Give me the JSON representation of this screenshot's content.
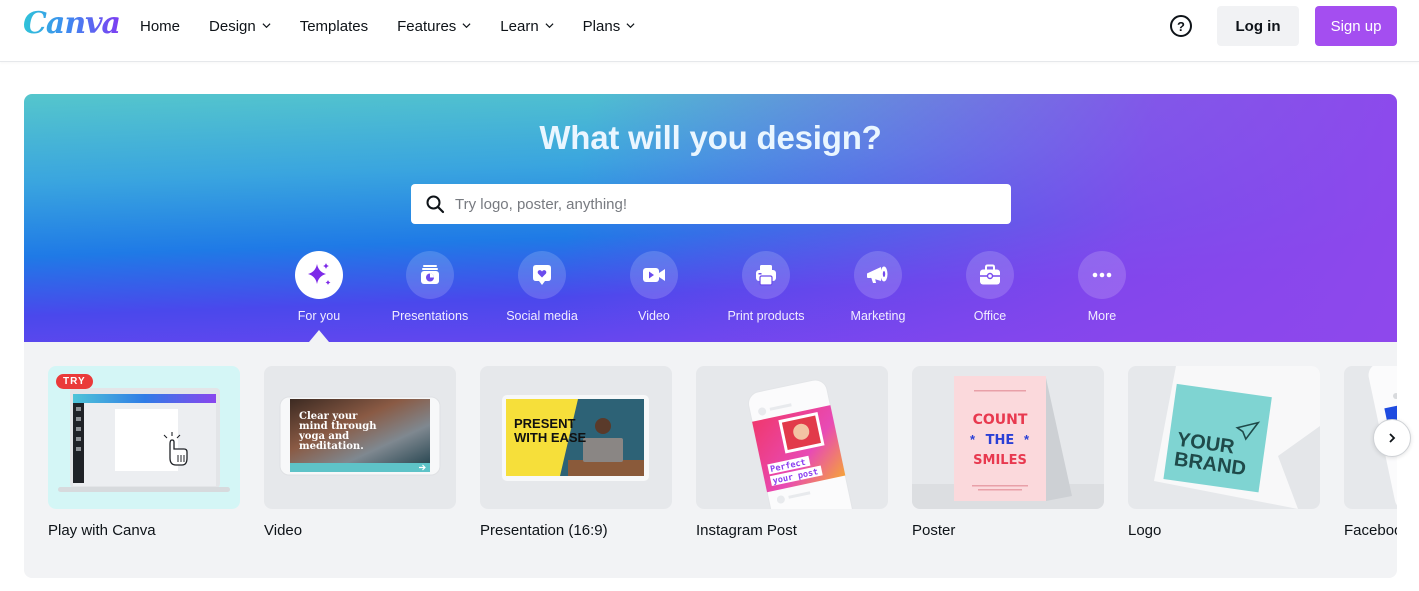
{
  "header": {
    "logo": "Canva",
    "nav": [
      {
        "label": "Home",
        "has_dropdown": false
      },
      {
        "label": "Design",
        "has_dropdown": true
      },
      {
        "label": "Templates",
        "has_dropdown": false
      },
      {
        "label": "Features",
        "has_dropdown": true
      },
      {
        "label": "Learn",
        "has_dropdown": true
      },
      {
        "label": "Plans",
        "has_dropdown": true
      }
    ],
    "help_icon": "question-circle-icon",
    "login_label": "Log in",
    "signup_label": "Sign up"
  },
  "hero": {
    "title": "What will you design?",
    "search": {
      "placeholder": "Try logo, poster, anything!",
      "value": "",
      "icon": "search-icon"
    },
    "categories": [
      {
        "label": "For you",
        "icon": "sparkle-icon",
        "active": true
      },
      {
        "label": "Presentations",
        "icon": "presentation-chart-icon",
        "active": false
      },
      {
        "label": "Social media",
        "icon": "heart-message-icon",
        "active": false
      },
      {
        "label": "Video",
        "icon": "video-camera-icon",
        "active": false
      },
      {
        "label": "Print products",
        "icon": "printer-icon",
        "active": false
      },
      {
        "label": "Marketing",
        "icon": "megaphone-icon",
        "active": false
      },
      {
        "label": "Office",
        "icon": "briefcase-icon",
        "active": false
      },
      {
        "label": "More",
        "icon": "more-dots-icon",
        "active": false
      }
    ]
  },
  "templates": {
    "items": [
      {
        "label": "Play with Canva",
        "badge": "TRY"
      },
      {
        "label": "Video",
        "thumb_text": "Clear your mind through yoga and meditation."
      },
      {
        "label": "Presentation (16:9)",
        "thumb_text": "PRESENT WITH EASE"
      },
      {
        "label": "Instagram Post",
        "thumb_text": "Perfect your post"
      },
      {
        "label": "Poster",
        "thumb_text": "COUNT THE SMILES"
      },
      {
        "label": "Logo",
        "thumb_text": "YOUR BRAND"
      },
      {
        "label": "Facebook"
      }
    ],
    "next_icon": "chevron-right-icon"
  },
  "colors": {
    "accent": "#a44ef0",
    "try_badge": "#ea3a3a",
    "login_bg": "#f1f2f4",
    "strip_bg": "#f2f3f5"
  }
}
